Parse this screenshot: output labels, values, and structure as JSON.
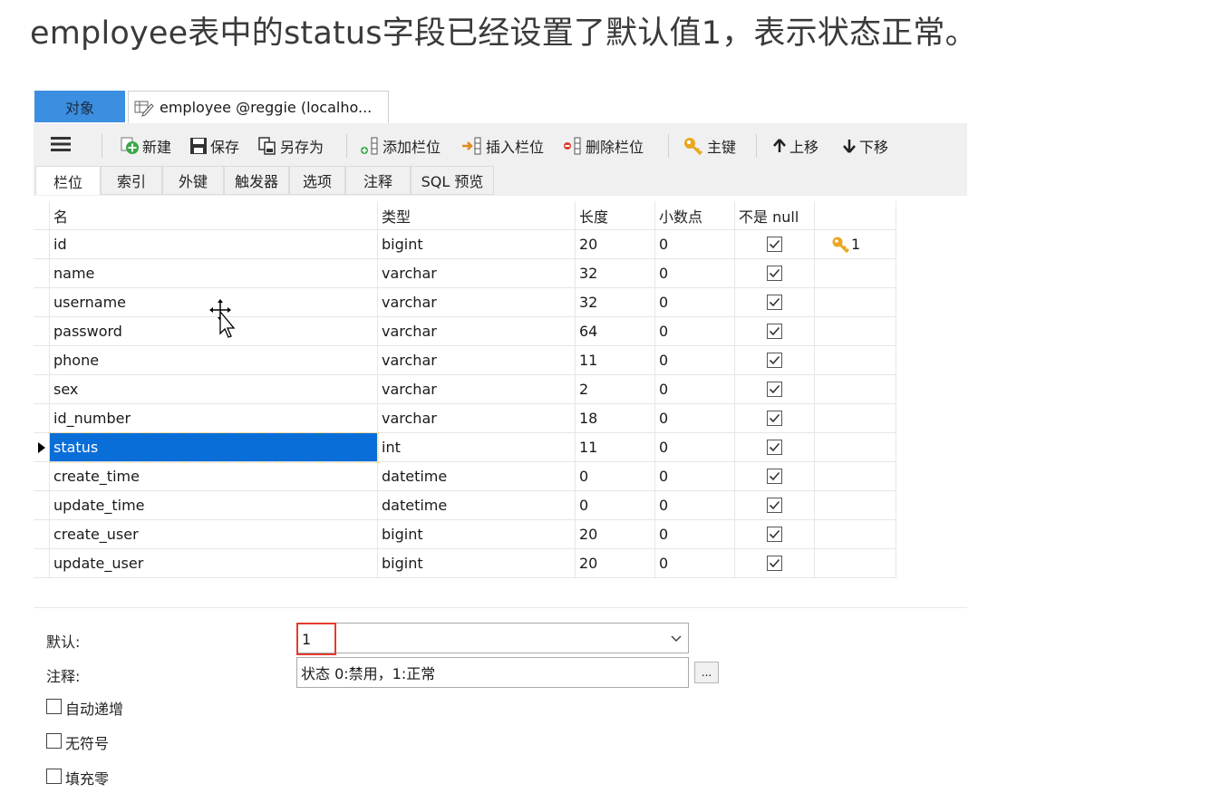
{
  "heading": "employee表中的status字段已经设置了默认值1，表示状态正常。",
  "tabs": {
    "objects": "对象",
    "document": "employee @reggie (localho..."
  },
  "toolbar": {
    "new": "新建",
    "save": "保存",
    "save_as": "另存为",
    "add_field": "添加栏位",
    "insert_field": "插入栏位",
    "delete_field": "删除栏位",
    "primary_key": "主键",
    "move_up": "上移",
    "move_down": "下移"
  },
  "subtabs": [
    "栏位",
    "索引",
    "外键",
    "触发器",
    "选项",
    "注释",
    "SQL 预览"
  ],
  "columns": {
    "name": "名",
    "type": "类型",
    "length": "长度",
    "decimals": "小数点",
    "not_null": "不是 null"
  },
  "rows": [
    {
      "name": "id",
      "type": "bigint",
      "length": "20",
      "decimals": "0",
      "not_null": true,
      "key": "1"
    },
    {
      "name": "name",
      "type": "varchar",
      "length": "32",
      "decimals": "0",
      "not_null": true,
      "key": ""
    },
    {
      "name": "username",
      "type": "varchar",
      "length": "32",
      "decimals": "0",
      "not_null": true,
      "key": ""
    },
    {
      "name": "password",
      "type": "varchar",
      "length": "64",
      "decimals": "0",
      "not_null": true,
      "key": ""
    },
    {
      "name": "phone",
      "type": "varchar",
      "length": "11",
      "decimals": "0",
      "not_null": true,
      "key": ""
    },
    {
      "name": "sex",
      "type": "varchar",
      "length": "2",
      "decimals": "0",
      "not_null": true,
      "key": ""
    },
    {
      "name": "id_number",
      "type": "varchar",
      "length": "18",
      "decimals": "0",
      "not_null": true,
      "key": ""
    },
    {
      "name": "status",
      "type": "int",
      "length": "11",
      "decimals": "0",
      "not_null": true,
      "key": "",
      "selected": true
    },
    {
      "name": "create_time",
      "type": "datetime",
      "length": "0",
      "decimals": "0",
      "not_null": true,
      "key": ""
    },
    {
      "name": "update_time",
      "type": "datetime",
      "length": "0",
      "decimals": "0",
      "not_null": true,
      "key": ""
    },
    {
      "name": "create_user",
      "type": "bigint",
      "length": "20",
      "decimals": "0",
      "not_null": true,
      "key": ""
    },
    {
      "name": "update_user",
      "type": "bigint",
      "length": "20",
      "decimals": "0",
      "not_null": true,
      "key": ""
    }
  ],
  "properties": {
    "default_label": "默认:",
    "default_value": "1",
    "comment_label": "注释:",
    "comment_value": "状态 0:禁用，1:正常",
    "ellipsis": "...",
    "auto_increment": "自动递增",
    "unsigned": "无符号",
    "zerofill": "填充零"
  },
  "colors": {
    "selection": "#0a6ed8",
    "objects_tab": "#3c8fe0",
    "highlight_border": "#e53b2e"
  }
}
